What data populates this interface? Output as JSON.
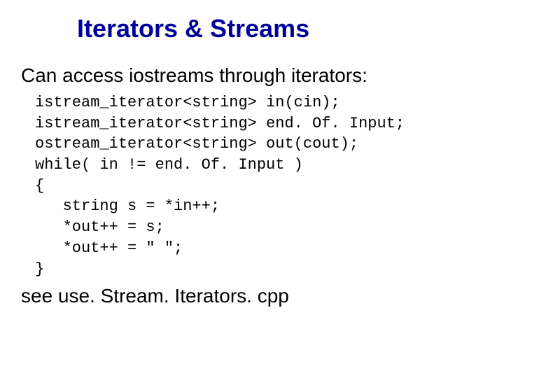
{
  "title": "Iterators & Streams",
  "subtitle": "Can access iostreams through iterators:",
  "code": {
    "line1": "istream_iterator<string> in(cin);",
    "line2": "istream_iterator<string> end. Of. Input;",
    "line3": "ostream_iterator<string> out(cout);",
    "line4": "while( in != end. Of. Input )",
    "line5": "{",
    "line6": "   string s = *in++;",
    "line7": "   *out++ = s;",
    "line8": "   *out++ = \" \";",
    "line9": "}"
  },
  "footer": "see use. Stream. Iterators. cpp"
}
